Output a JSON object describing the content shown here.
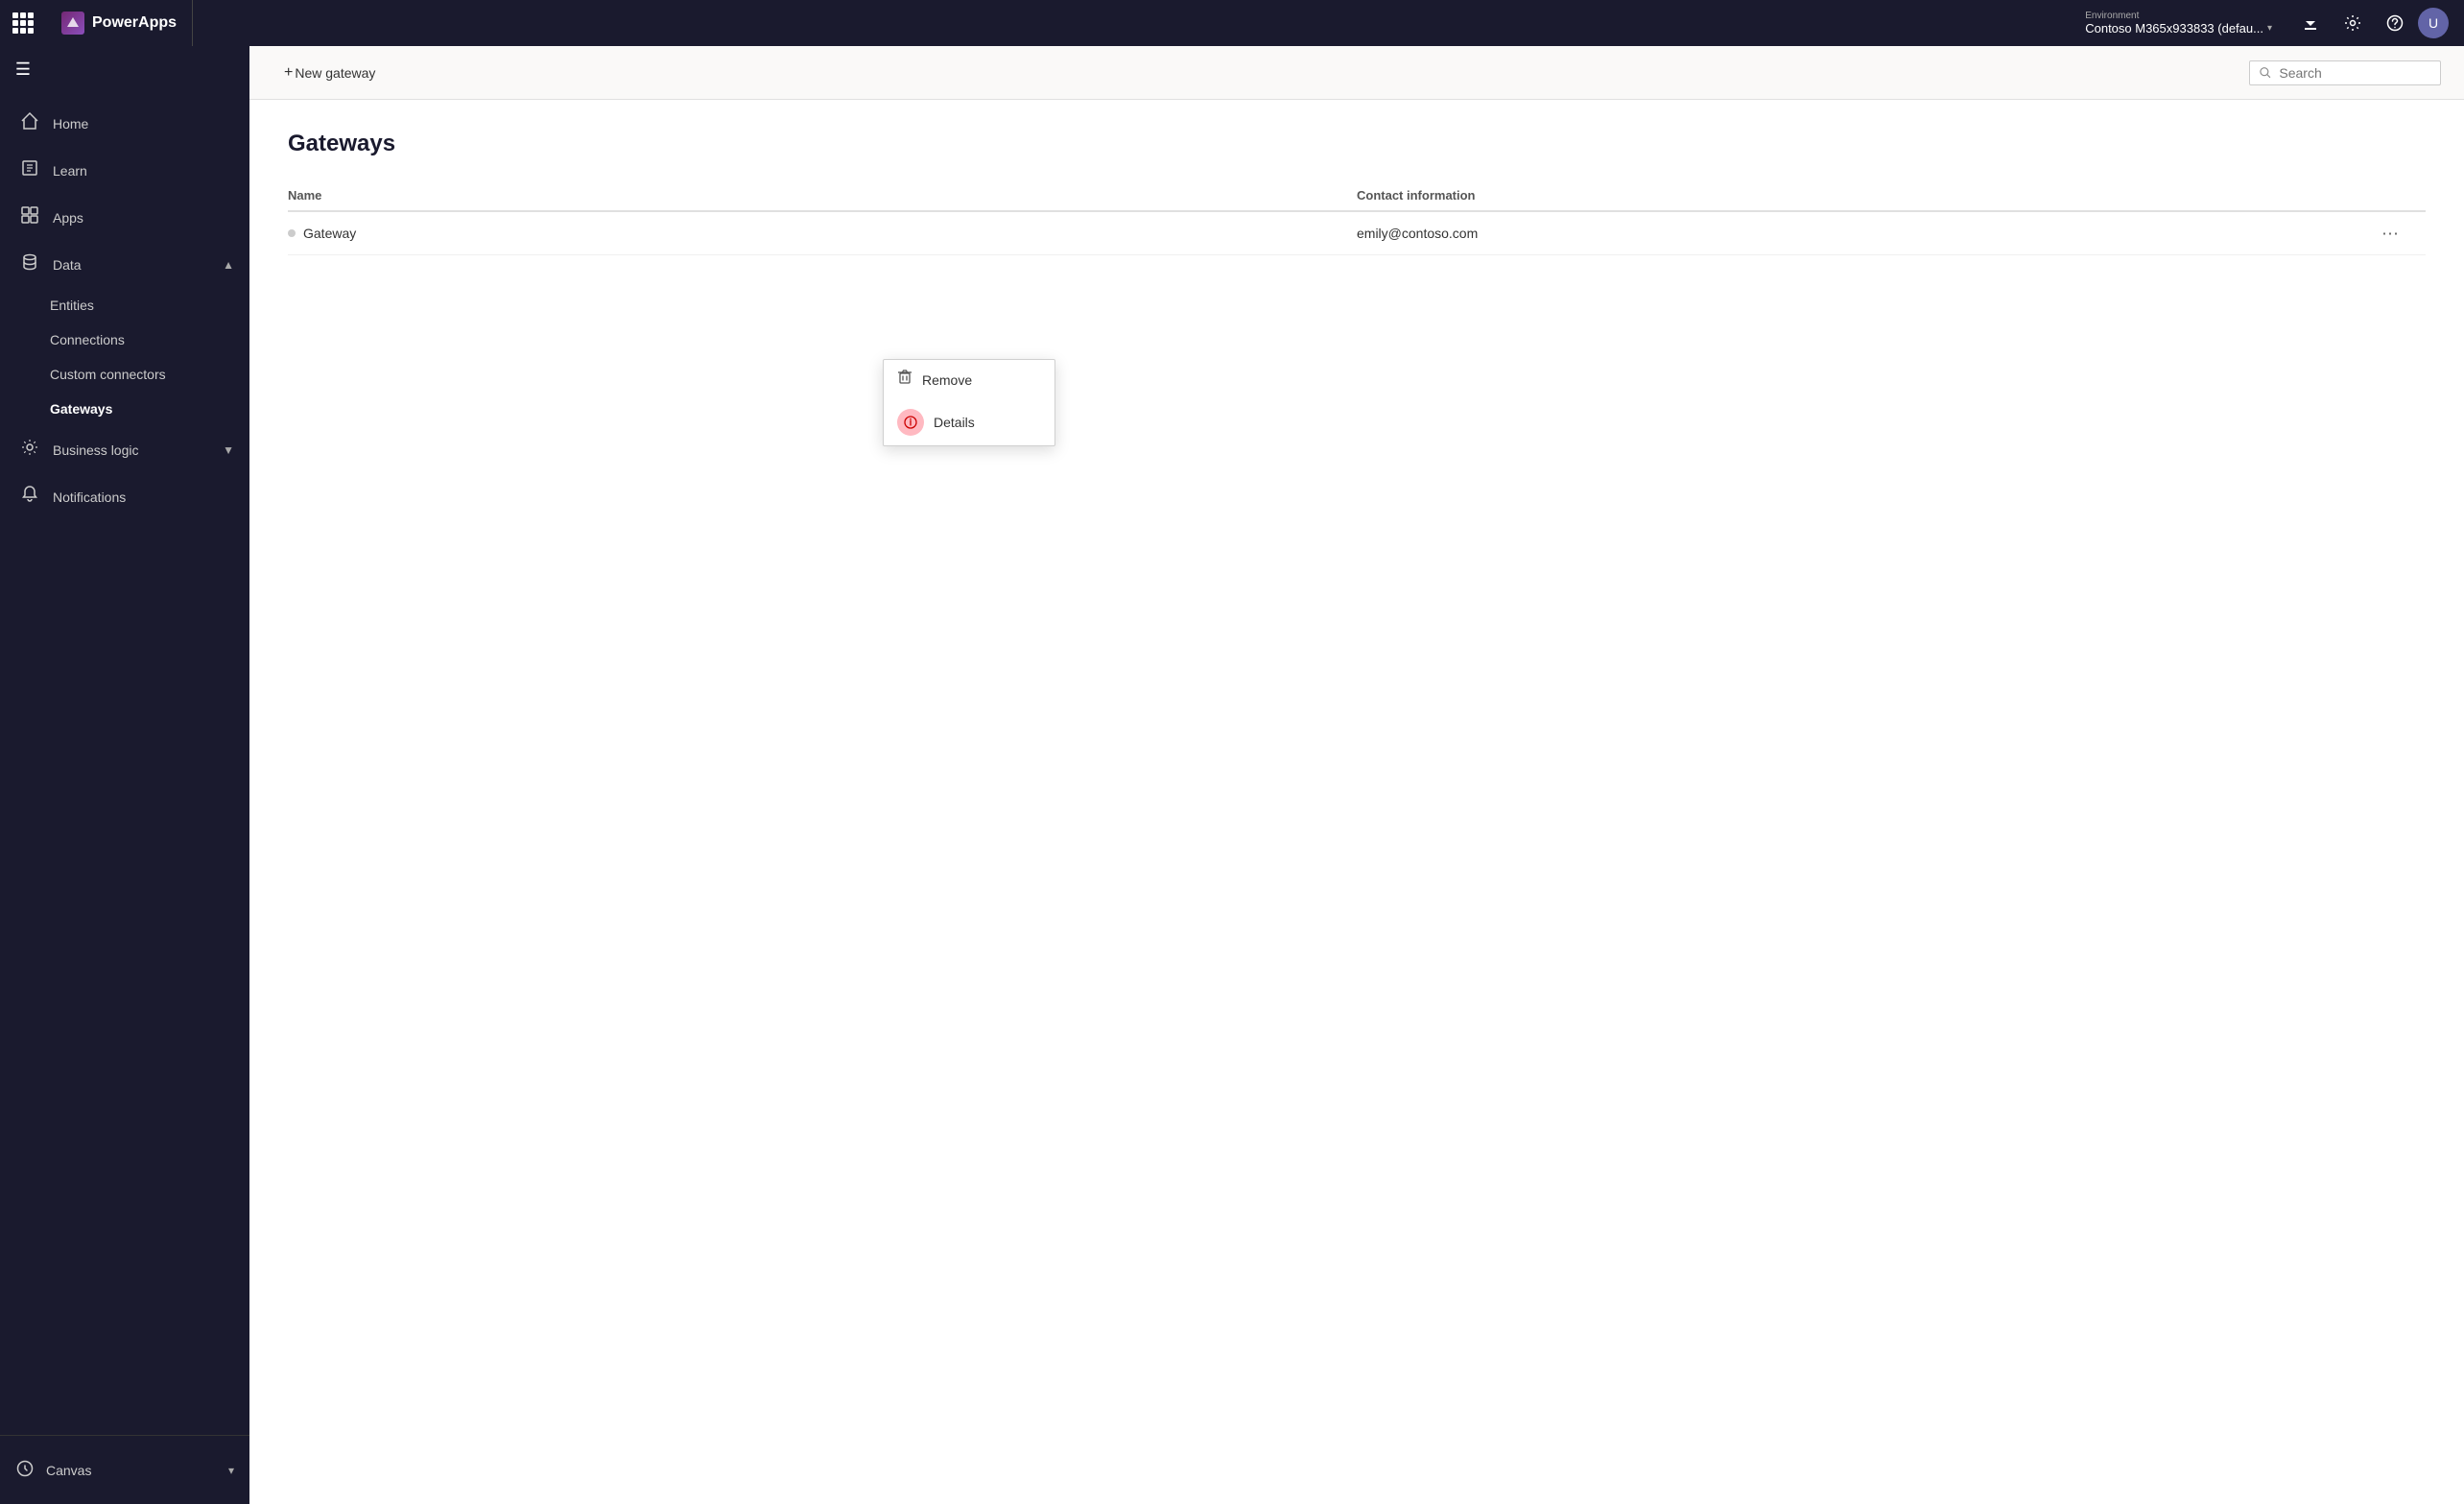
{
  "topbar": {
    "app_name": "PowerApps",
    "env_label": "Environment",
    "env_name": "Contoso M365x933833 (defau...",
    "download_icon": "⬇",
    "settings_icon": "⚙",
    "help_icon": "?",
    "avatar_letter": "U"
  },
  "sidebar": {
    "toggle_icon": "☰",
    "items": [
      {
        "id": "home",
        "label": "Home",
        "icon": "⌂"
      },
      {
        "id": "learn",
        "label": "Learn",
        "icon": "📖"
      },
      {
        "id": "apps",
        "label": "Apps",
        "icon": "⊞"
      },
      {
        "id": "data",
        "label": "Data",
        "icon": "⊟",
        "expanded": true
      },
      {
        "id": "entities",
        "label": "Entities",
        "sub": true
      },
      {
        "id": "connections",
        "label": "Connections",
        "sub": true
      },
      {
        "id": "custom-connectors",
        "label": "Custom connectors",
        "sub": true
      },
      {
        "id": "gateways",
        "label": "Gateways",
        "active": true,
        "sub": true
      },
      {
        "id": "business-logic",
        "label": "Business logic",
        "icon": "⚙",
        "expandable": true
      },
      {
        "id": "notifications",
        "label": "Notifications",
        "icon": "🔔"
      }
    ],
    "footer": {
      "label": "Canvas",
      "icon": "?"
    }
  },
  "toolbar": {
    "new_gateway_label": "+ New gateway",
    "search_placeholder": "Search"
  },
  "page": {
    "title": "Gateways",
    "table": {
      "col_name": "Name",
      "col_contact": "Contact information",
      "rows": [
        {
          "name": "Gateway",
          "contact": "emily@contoso.com"
        }
      ]
    }
  },
  "context_menu": {
    "items": [
      {
        "id": "remove",
        "label": "Remove",
        "icon": "🗑"
      },
      {
        "id": "details",
        "label": "Details",
        "icon": "ℹ"
      }
    ]
  }
}
